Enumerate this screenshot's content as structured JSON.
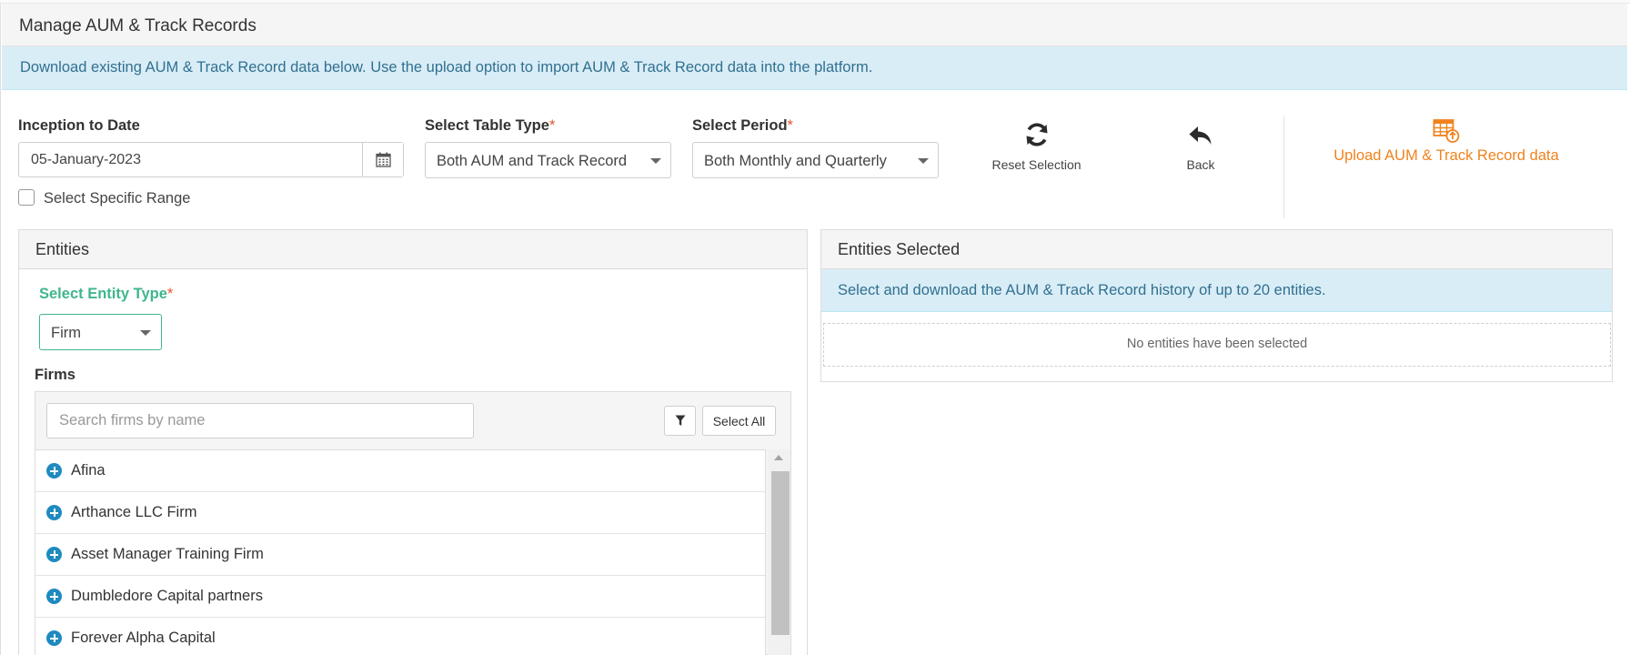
{
  "page": {
    "title": "Manage AUM & Track Records",
    "info_banner": "Download existing AUM & Track Record data below. Use the upload option to import AUM & Track Record data into the platform."
  },
  "filters": {
    "inception_label": "Inception to Date",
    "inception_value": "05-January-2023",
    "specific_range_label": "Select Specific Range",
    "table_type_label": "Select Table Type",
    "table_type_value": "Both AUM and Track Record",
    "period_label": "Select Period",
    "period_value": "Both Monthly and Quarterly",
    "required_mark": "*"
  },
  "actions": {
    "reset_label": "Reset Selection",
    "back_label": "Back",
    "upload_label": "Upload AUM & Track Record data"
  },
  "entities_panel": {
    "title": "Entities",
    "entity_type_label": "Select Entity Type",
    "entity_type_value": "Firm",
    "firms_label": "Firms",
    "search_placeholder": "Search firms by name",
    "select_all_label": "Select All",
    "firms": [
      "Afina",
      "Arthance LLC Firm",
      "Asset Manager Training Firm",
      "Dumbledore Capital partners",
      "Forever Alpha Capital"
    ]
  },
  "selected_panel": {
    "title": "Entities Selected",
    "info": "Select and download the AUM & Track Record history of up to 20 entities.",
    "empty_text": "No entities have been selected"
  },
  "colors": {
    "accent_orange": "#f0821e",
    "accent_green": "#3fb68b",
    "info_bg": "#d9edf7",
    "info_text": "#31708f",
    "plus_blue": "#1f8ac0"
  }
}
